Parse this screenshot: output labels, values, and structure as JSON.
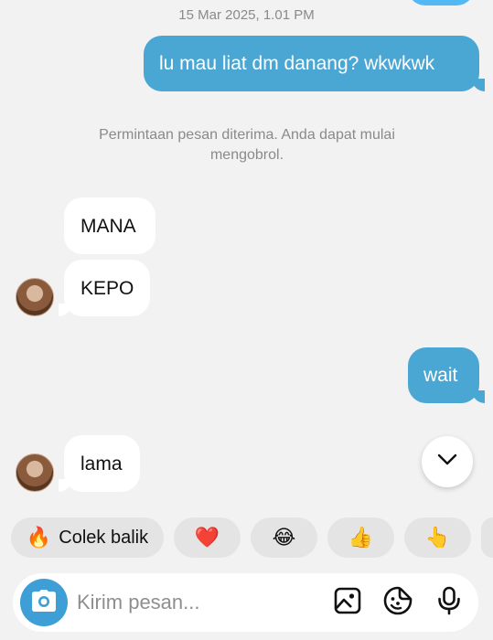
{
  "header": {
    "timestamp": "15 Mar 2025, 1.01 PM"
  },
  "messages": [
    {
      "from": "me",
      "text": "lu mau liat dm danang? wkwkwk"
    },
    {
      "from": "them",
      "text": "MANA"
    },
    {
      "from": "them",
      "text": "KEPO"
    },
    {
      "from": "me",
      "text": "wait"
    },
    {
      "from": "them",
      "text": "lama"
    }
  ],
  "system_note": "Permintaan pesan diterima. Anda dapat mulai mengobrol.",
  "quick_replies": [
    {
      "emoji": "🔥",
      "label": "Colek balik"
    },
    {
      "emoji": "❤️",
      "label": ""
    },
    {
      "emoji": "😂",
      "label": ""
    },
    {
      "emoji": "👍",
      "label": ""
    },
    {
      "emoji": "👆",
      "label": ""
    }
  ],
  "composer": {
    "placeholder": "Kirim pesan..."
  },
  "colors": {
    "outgoing_bubble": "#4aa6d2",
    "incoming_bubble": "#ffffff",
    "camera_button": "#3d9fd6",
    "background": "#f2f2f2"
  },
  "icons": [
    "camera-icon",
    "image-icon",
    "sticker-icon",
    "microphone-icon",
    "chevron-down-icon"
  ]
}
